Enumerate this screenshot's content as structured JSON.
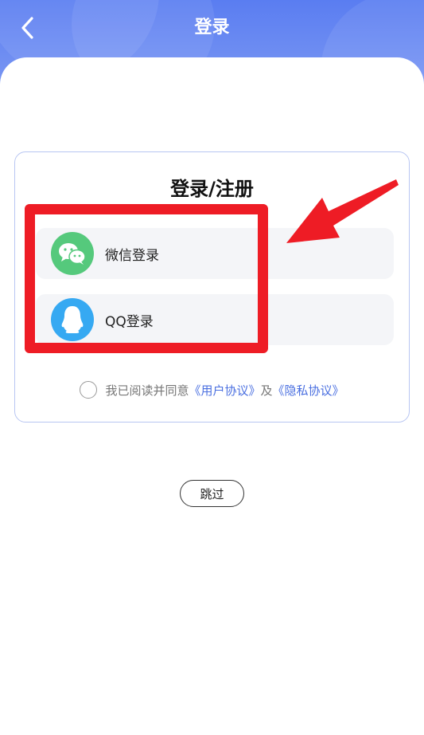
{
  "header": {
    "title": "登录",
    "back_icon": "chevron-left-icon"
  },
  "card": {
    "title": "登录/注册",
    "options": [
      {
        "label": "微信登录",
        "icon": "wechat-icon",
        "color": "#55c97c"
      },
      {
        "label": "QQ登录",
        "icon": "qq-penguin-icon",
        "color": "#36a9f2"
      }
    ],
    "agreement": {
      "prefix": "我已阅读并同意",
      "user_agreement": "《用户协议》",
      "joiner": "及",
      "privacy_policy": "《隐私协议》"
    }
  },
  "skip_label": "跳过",
  "colors": {
    "header_blue": "#5a7df1",
    "link": "#4a6fe0",
    "annotation_red": "#ee1c25"
  }
}
